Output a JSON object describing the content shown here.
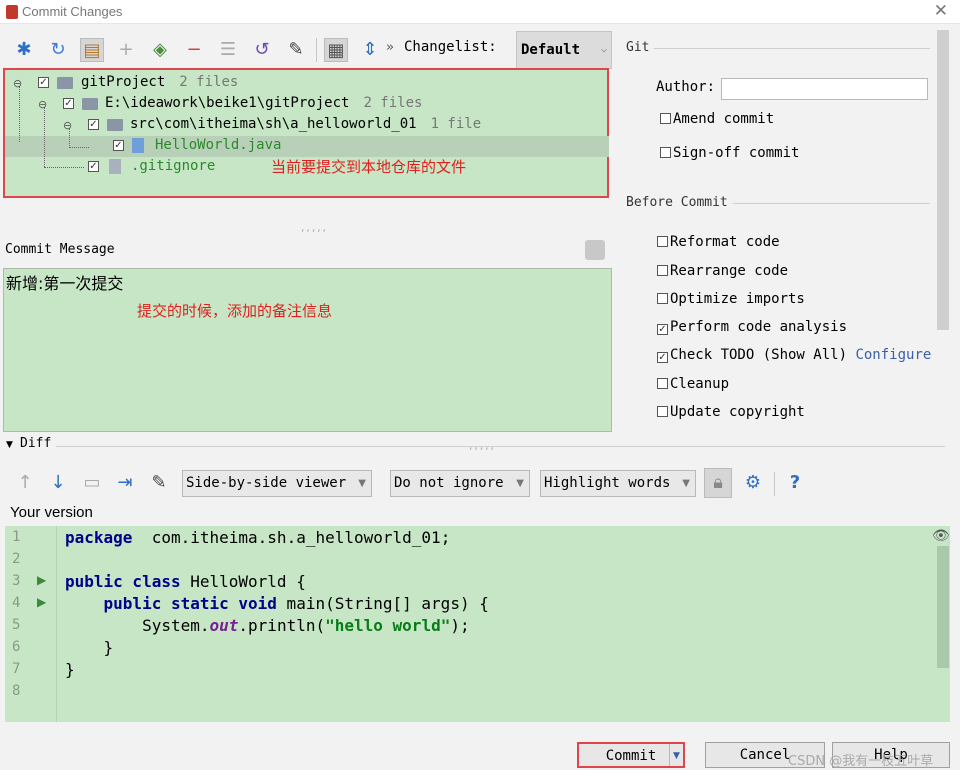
{
  "window": {
    "title": "Commit Changes"
  },
  "toolbar": {
    "changelist_label": "Changelist:",
    "changelist_value": "Default"
  },
  "tree": {
    "root": {
      "label": "gitProject",
      "count": "2 files"
    },
    "repo": {
      "label": "E:\\ideawork\\beike1\\gitProject",
      "count": "2 files"
    },
    "dir": {
      "label": "src\\com\\itheima\\sh\\a_helloworld_01",
      "count": "1 file"
    },
    "file1": "HelloWorld.java",
    "file2": ".gitignore",
    "annotation": "当前要提交到本地仓库的文件"
  },
  "commit_message": {
    "label": "Commit Message",
    "text": "新增:第一次提交",
    "annotation": "提交的时候，添加的备注信息"
  },
  "git_section": {
    "title": "Git",
    "author_label": "Author:",
    "author_value": "",
    "amend": "Amend commit",
    "signoff": "Sign-off commit"
  },
  "before_commit": {
    "title": "Before Commit",
    "options": [
      {
        "label": "Reformat code",
        "checked": false
      },
      {
        "label": "Rearrange code",
        "checked": false
      },
      {
        "label": "Optimize imports",
        "checked": false
      },
      {
        "label": "Perform code analysis",
        "checked": true
      },
      {
        "label": "Check TODO (Show All)",
        "checked": true
      },
      {
        "label": "Cleanup",
        "checked": false
      },
      {
        "label": "Update copyright",
        "checked": false
      }
    ],
    "configure_link": "Configure"
  },
  "diff": {
    "label": "Diff",
    "viewer": "Side-by-side viewer",
    "whitespace": "Do not ignore",
    "highlight": "Highlight words",
    "your_version": "Your version",
    "help_icon": "?"
  },
  "code_lines": [
    {
      "num": "1",
      "parts": [
        [
          "kw",
          "package"
        ],
        [
          "",
          "  com.itheima.sh.a_helloworld_01;"
        ]
      ]
    },
    {
      "num": "2",
      "parts": []
    },
    {
      "num": "3",
      "parts": [
        [
          "kw",
          "public class"
        ],
        [
          "",
          " HelloWorld {"
        ]
      ]
    },
    {
      "num": "4",
      "parts": [
        [
          "",
          "    "
        ],
        [
          "kw",
          "public static void"
        ],
        [
          "",
          " main(String[] args) {"
        ]
      ]
    },
    {
      "num": "5",
      "parts": [
        [
          "",
          "        System."
        ],
        [
          "ital",
          "out"
        ],
        [
          "",
          ".println("
        ],
        [
          "str",
          "\"hello world\""
        ],
        [
          "",
          ");"
        ]
      ]
    },
    {
      "num": "6",
      "parts": [
        [
          "",
          "    }"
        ]
      ]
    },
    {
      "num": "7",
      "parts": [
        [
          "",
          "}"
        ]
      ]
    },
    {
      "num": "8",
      "parts": []
    }
  ],
  "buttons": {
    "commit": "Commit",
    "cancel": "Cancel",
    "help": "Help"
  },
  "watermark": "CSDN @我有一枝五叶草"
}
